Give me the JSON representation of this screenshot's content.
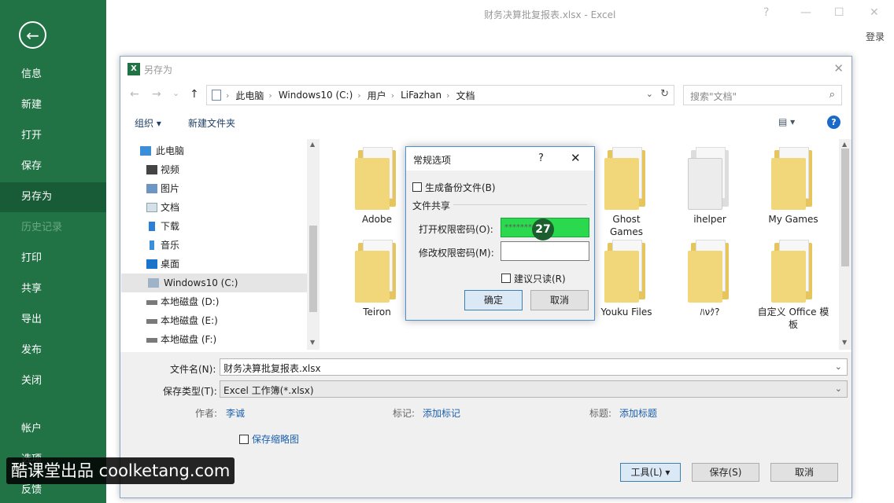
{
  "app": {
    "window_title": "财务决算批复报表.xlsx - Excel",
    "sign_in": "登录",
    "ctrl_help": "?",
    "ctrl_min": "—",
    "ctrl_max": "☐",
    "ctrl_close": "✕"
  },
  "backstage": {
    "back": "←",
    "items": [
      "信息",
      "新建",
      "打开",
      "保存",
      "另存为",
      "历史记录",
      "打印",
      "共享",
      "导出",
      "发布",
      "关闭",
      "帐户",
      "选项",
      "反馈"
    ]
  },
  "saveas": {
    "title": "另存为",
    "icon_text": "X",
    "close": "✕",
    "nav": {
      "back": "←",
      "forward": "→",
      "down": "⌄",
      "up": "↑"
    },
    "breadcrumb": [
      "此电脑",
      "Windows10 (C:)",
      "用户",
      "LiFazhan",
      "文档"
    ],
    "search_placeholder": "搜索\"文档\"",
    "toolbar": {
      "organize": "组织 ▾",
      "new_folder": "新建文件夹",
      "view": "▤ ▾",
      "help": "?"
    },
    "tree": [
      {
        "label": "此电脑"
      },
      {
        "label": "视频"
      },
      {
        "label": "图片"
      },
      {
        "label": "文档"
      },
      {
        "label": "下载"
      },
      {
        "label": "音乐"
      },
      {
        "label": "桌面"
      },
      {
        "label": "Windows10 (C:)"
      },
      {
        "label": "本地磁盘 (D:)"
      },
      {
        "label": "本地磁盘 (E:)"
      },
      {
        "label": "本地磁盘 (F:)"
      }
    ],
    "folders": [
      "Adobe",
      "",
      "",
      "Ghost Games",
      "ihelper",
      "My Games",
      "Teiron",
      "",
      "",
      "Youku Files",
      "ﾊνｸ?",
      "自定义 Office 模板"
    ],
    "filename_label": "文件名(N):",
    "filename_value": "财务决算批复报表.xlsx",
    "filetype_label": "保存类型(T):",
    "filetype_value": "Excel 工作簿(*.xlsx)",
    "author_label": "作者:",
    "author_value": "李诚",
    "tags_label": "标记:",
    "tags_value": "添加标记",
    "title_label": "标题:",
    "title_value": "添加标题",
    "thumbnail_label": "保存缩略图",
    "tools_button": "工具(L)",
    "save_button": "保存(S)",
    "cancel_button": "取消"
  },
  "options_dialog": {
    "title": "常规选项",
    "help": "?",
    "close": "✕",
    "backup_label": "生成备份文件(B)",
    "file_sharing": "文件共享",
    "open_pw_label": "打开权限密码(O):",
    "open_pw_value": "********",
    "modify_pw_label": "修改权限密码(M):",
    "readonly_label": "建议只读(R)",
    "ok_button": "确定",
    "cancel_button": "取消",
    "step": "27"
  },
  "watermark": "酷课堂出品 coolketang.com"
}
